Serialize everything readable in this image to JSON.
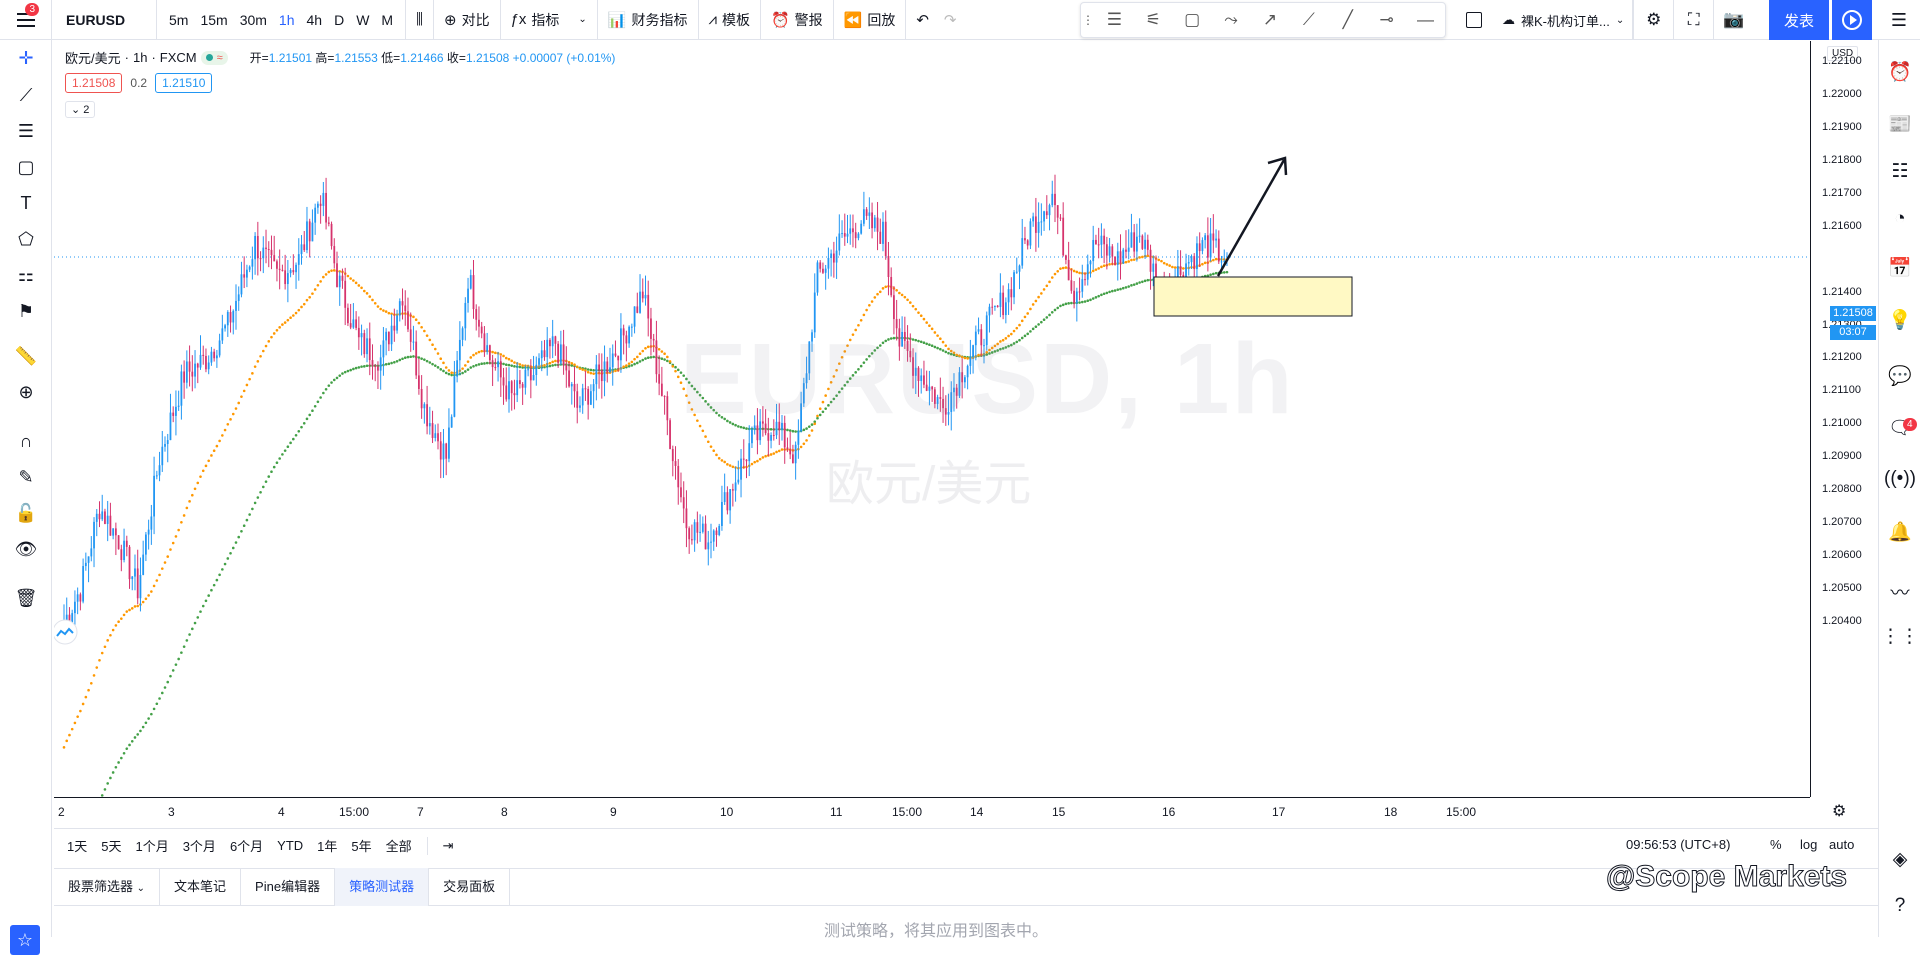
{
  "topbar": {
    "menu_badge": "3",
    "symbol": "EURUSD",
    "intervals": [
      "5m",
      "15m",
      "30m",
      "1h",
      "4h",
      "D",
      "W",
      "M"
    ],
    "active_interval": "1h",
    "compare_label": "对比",
    "indicators_label": "指标",
    "financials_label": "财务指标",
    "templates_label": "模板",
    "alert_label": "警报",
    "replay_label": "回放",
    "layout_label": "裸K-机构订单...",
    "publish_label": "发表"
  },
  "legend": {
    "pair": "欧元/美元",
    "interval": "1h",
    "exchange": "FXCM",
    "open_label": "开=",
    "open": "1.21501",
    "high_label": "高=",
    "high": "1.21553",
    "low_label": "低=",
    "low": "1.21466",
    "close_label": "收=",
    "close": "1.21508",
    "change": "+0.00007 (+0.01%)",
    "sell_price": "1.21508",
    "spread": "0.2",
    "buy_price": "1.21510",
    "collapsed_count": "2"
  },
  "watermark": {
    "main": "EURUSD, 1h",
    "sub": "欧元/美元"
  },
  "price_scale": {
    "currency": "USD",
    "labels": [
      "1.22100",
      "1.22000",
      "1.21900",
      "1.21800",
      "1.21700",
      "1.21600",
      "1.21400",
      "1.21300",
      "1.21200",
      "1.21100",
      "1.21000",
      "1.20900",
      "1.20800",
      "1.20700",
      "1.20600",
      "1.20500",
      "1.20400"
    ],
    "current_price": "1.21508",
    "countdown": "03:07"
  },
  "time_scale": {
    "labels": [
      "2",
      "3",
      "4",
      "15:00",
      "7",
      "8",
      "9",
      "10",
      "11",
      "15:00",
      "14",
      "15",
      "16",
      "17",
      "18",
      "15:00"
    ]
  },
  "range_bar": {
    "ranges": [
      "1天",
      "5天",
      "1个月",
      "3个月",
      "6个月",
      "YTD",
      "1年",
      "5年",
      "全部"
    ],
    "clock": "09:56:53 (UTC+8)",
    "percent": "%",
    "log": "log",
    "auto": "auto"
  },
  "bottom_panel": {
    "tabs": [
      "股票筛选器",
      "文本笔记",
      "Pine编辑器",
      "策略测试器",
      "交易面板"
    ],
    "active_tab": "策略测试器",
    "message": "测试策略，将其应用到图表中。"
  },
  "right_sidebar": {
    "chat_badge": "4"
  },
  "brand": "@Scope Markets",
  "colors": {
    "accent": "#2962ff",
    "up_candle": "#2196f3",
    "down_candle": "#d6336c",
    "ema_fast": "#ff9800",
    "ema_slow": "#43a047",
    "zone_fill": "#fff9c4"
  },
  "chart_data": {
    "type": "candlestick",
    "symbol": "EURUSD",
    "timeframe": "1h",
    "ylim": [
      1.2035,
      1.222
    ],
    "approx_path": [
      [
        0,
        1.204
      ],
      [
        6,
        1.205
      ],
      [
        13,
        1.2075
      ],
      [
        20,
        1.2065
      ],
      [
        27,
        1.205
      ],
      [
        35,
        1.209
      ],
      [
        44,
        1.2115
      ],
      [
        52,
        1.212
      ],
      [
        60,
        1.213
      ],
      [
        70,
        1.2155
      ],
      [
        78,
        1.2145
      ],
      [
        86,
        1.215
      ],
      [
        94,
        1.217
      ],
      [
        100,
        1.2145
      ],
      [
        108,
        1.2125
      ],
      [
        116,
        1.212
      ],
      [
        124,
        1.214
      ],
      [
        132,
        1.2105
      ],
      [
        140,
        1.209
      ],
      [
        148,
        1.2145
      ],
      [
        156,
        1.212
      ],
      [
        164,
        1.2108
      ],
      [
        172,
        1.2115
      ],
      [
        180,
        1.2125
      ],
      [
        188,
        1.2105
      ],
      [
        196,
        1.2115
      ],
      [
        204,
        1.2125
      ],
      [
        212,
        1.214
      ],
      [
        220,
        1.2105
      ],
      [
        228,
        1.207
      ],
      [
        236,
        1.2065
      ],
      [
        244,
        1.208
      ],
      [
        252,
        1.2095
      ],
      [
        260,
        1.21
      ],
      [
        268,
        1.209
      ],
      [
        276,
        1.2145
      ],
      [
        284,
        1.2155
      ],
      [
        292,
        1.2162
      ],
      [
        300,
        1.2158
      ],
      [
        306,
        1.2125
      ],
      [
        314,
        1.2115
      ],
      [
        322,
        1.2105
      ],
      [
        330,
        1.2118
      ],
      [
        338,
        1.213
      ],
      [
        346,
        1.214
      ],
      [
        354,
        1.216
      ],
      [
        362,
        1.217
      ],
      [
        370,
        1.214
      ],
      [
        378,
        1.2155
      ],
      [
        386,
        1.215
      ],
      [
        394,
        1.2158
      ],
      [
        402,
        1.214
      ],
      [
        410,
        1.2148
      ],
      [
        418,
        1.2155
      ],
      [
        426,
        1.215
      ]
    ],
    "ema_fast": "orange dotted moving average",
    "ema_slow": "green dotted moving average"
  }
}
